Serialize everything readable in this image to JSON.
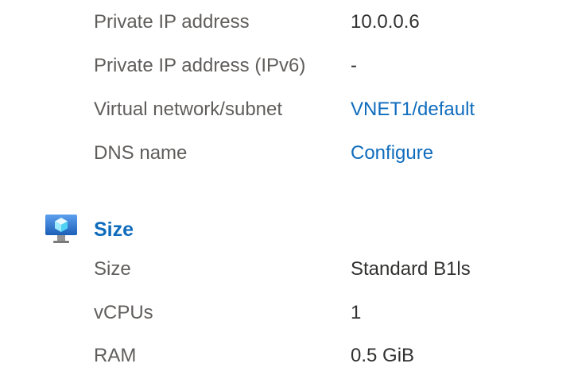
{
  "network": {
    "rows": [
      {
        "label": "Private IP address",
        "value": "10.0.0.6"
      },
      {
        "label": "Private IP address (IPv6)",
        "value": "-"
      },
      {
        "label": "Virtual network/subnet",
        "value": "VNET1/default"
      },
      {
        "label": "DNS name",
        "value": "Configure"
      }
    ]
  },
  "size_section": {
    "title": "Size",
    "icon": "virtual-machine-icon",
    "rows": [
      {
        "label": "Size",
        "value": "Standard B1ls"
      },
      {
        "label": "vCPUs",
        "value": "1"
      },
      {
        "label": "RAM",
        "value": "0.5 GiB"
      }
    ]
  },
  "colors": {
    "link": "#0f6cbd",
    "label": "#605e5c",
    "value": "#323130"
  }
}
